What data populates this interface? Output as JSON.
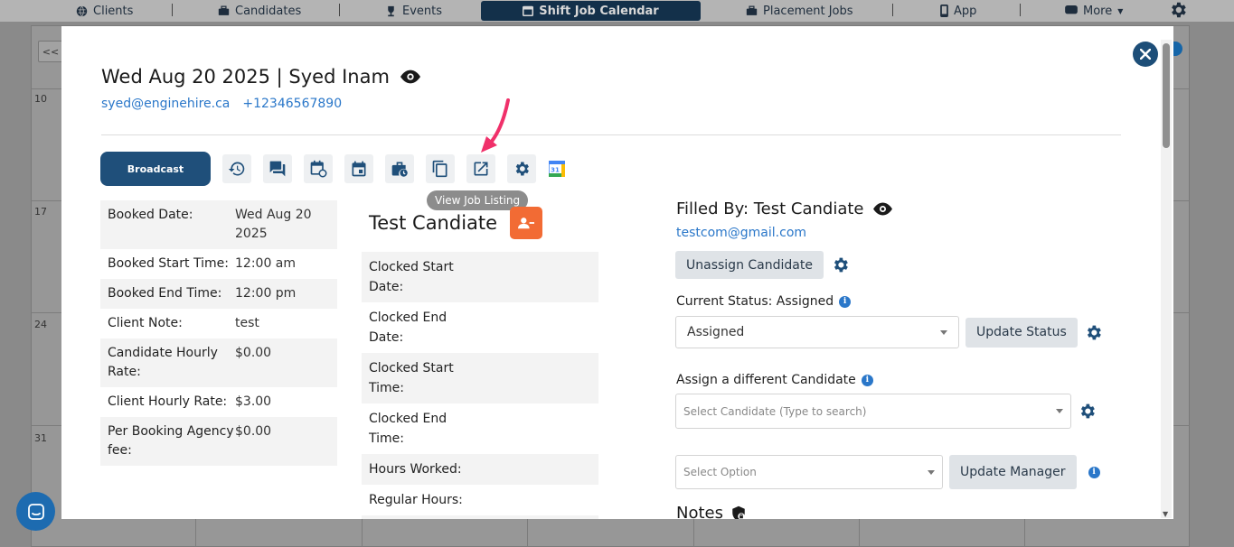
{
  "nav": {
    "items": [
      {
        "label": "Clients",
        "icon": "globe-icon"
      },
      {
        "label": "Candidates",
        "icon": "briefcase-icon"
      },
      {
        "label": "Events",
        "icon": "trophy-icon"
      },
      {
        "label": "Shift Job Calendar",
        "icon": "calendar-icon",
        "active": true
      },
      {
        "label": "Placement Jobs",
        "icon": "briefcase-icon"
      },
      {
        "label": "App",
        "icon": "phone-icon"
      },
      {
        "label": "More",
        "icon": "chat-icon"
      }
    ]
  },
  "calendar": {
    "prev_label": "<<",
    "day_numbers": [
      "10",
      "17",
      "24",
      "31"
    ]
  },
  "modal": {
    "title": "Wed Aug 20 2025 | Syed Inam",
    "email": "syed@enginehire.ca",
    "phone": "+12346567890",
    "broadcast_label": "Broadcast",
    "tooltip": "View Job Listing",
    "details": [
      {
        "label": "Booked Date:",
        "value": "Wed Aug 20 2025"
      },
      {
        "label": "Booked Start Time:",
        "value": "12:00 am"
      },
      {
        "label": "Booked End Time:",
        "value": "12:00 pm"
      },
      {
        "label": "Client Note:",
        "value": "test"
      },
      {
        "label": "Candidate Hourly Rate:",
        "value": "$0.00"
      },
      {
        "label": "Client Hourly Rate:",
        "value": "$3.00"
      },
      {
        "label": "Per Booking Agency fee:",
        "value": "$0.00"
      }
    ],
    "candidate_name": "Test Candiate",
    "clocked": [
      "Clocked Start Date:",
      "Clocked End Date:",
      "Clocked Start Time:",
      "Clocked End Time:",
      "Hours Worked:",
      "Regular Hours:"
    ],
    "filled_by": "Filled By: Test Candiate",
    "filled_email": "testcom@gmail.com",
    "unassign_label": "Unassign Candidate",
    "current_status_label": "Current Status: Assigned",
    "status_value": "Assigned",
    "update_status_label": "Update Status",
    "assign_label": "Assign a different Candidate",
    "candidate_placeholder": "Select Candidate (Type to search)",
    "option_placeholder": "Select Option",
    "update_manager_label": "Update Manager",
    "notes_label": "Notes"
  },
  "colors": {
    "primary": "#1f4f7a",
    "accent_orange": "#f26b34",
    "link": "#2a77c9"
  }
}
